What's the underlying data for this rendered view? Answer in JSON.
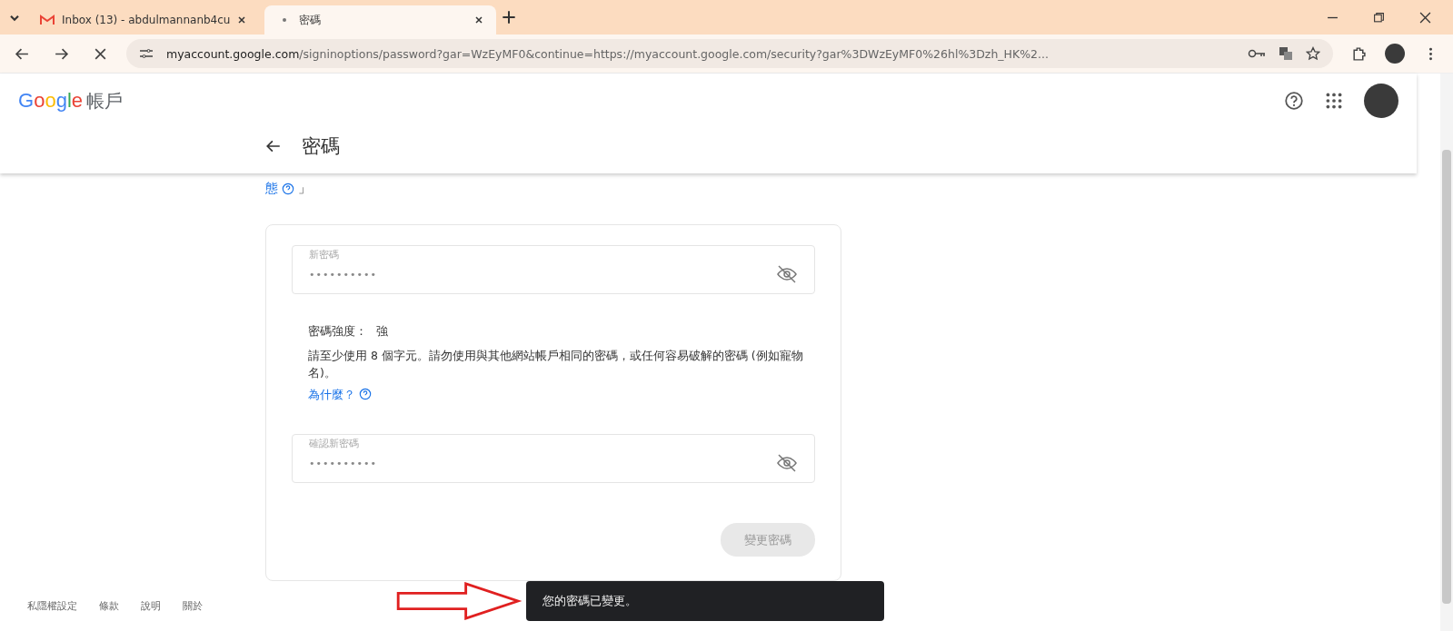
{
  "browser": {
    "tabs": [
      {
        "title": "Inbox (13) - abdulmannanb4cu",
        "kind": "mail",
        "selected": false
      },
      {
        "title": "密碼",
        "kind": "loading",
        "selected": true
      }
    ],
    "url_host": "myaccount.google.com",
    "url_rest": "/signinoptions/password?gar=WzEyMF0&continue=https://myaccount.google.com/security?gar%3DWzEyMF0%26hl%3Dzh_HK%2..."
  },
  "header": {
    "logo": "Google",
    "product": "帳戶",
    "page_title": "密碼"
  },
  "intro": {
    "link": "態",
    "tail": "」"
  },
  "form": {
    "fields": [
      {
        "label": "新密碼",
        "value": "••••••••••"
      },
      {
        "label": "確認新密碼",
        "value": "••••••••••"
      }
    ],
    "strength_label": "密碼強度：",
    "strength": "強",
    "hint": "請至少使用 8 個字元。請勿使用與其他網站帳戶相同的密碼，或任何容易破解的密碼 (例如寵物名)。",
    "hint_link": "為什麼？",
    "submit": {
      "label": "變更密碼",
      "disabled": true
    }
  },
  "toast": "您的密碼已變更。",
  "footer": [
    "私隱權設定",
    "條款",
    "說明",
    "關於"
  ]
}
